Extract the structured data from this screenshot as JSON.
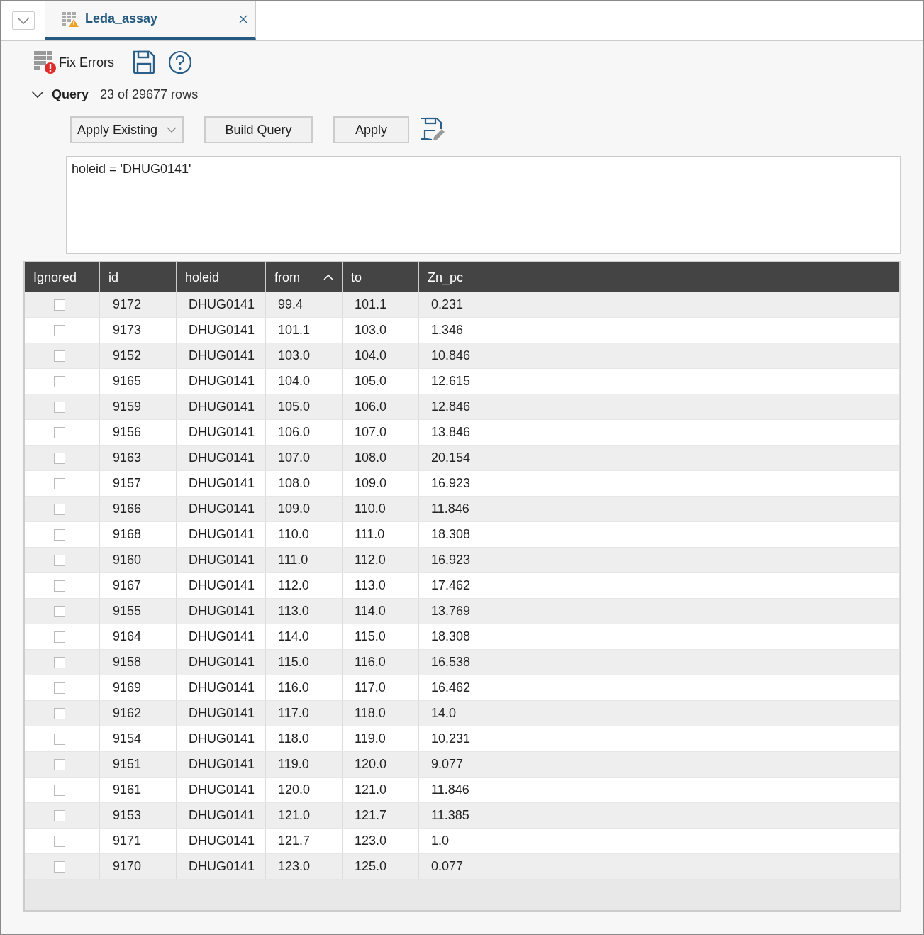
{
  "tab": {
    "title": "Leda_assay",
    "selected": true
  },
  "toolbar": {
    "fix_errors": "Fix Errors"
  },
  "query": {
    "label": "Query",
    "expanded": true,
    "count": "23 of 29677 rows",
    "apply_existing": "Apply Existing",
    "build_query": "Build Query",
    "apply": "Apply",
    "text": "holeid = 'DHUG0141'"
  },
  "table": {
    "columns": [
      {
        "label": "Ignored",
        "sorted": false
      },
      {
        "label": "id",
        "sorted": false
      },
      {
        "label": "holeid",
        "sorted": false
      },
      {
        "label": "from",
        "sorted": true
      },
      {
        "label": "to",
        "sorted": false
      },
      {
        "label": "Zn_pc",
        "sorted": false
      }
    ],
    "rows": [
      {
        "ignored": false,
        "id": "9172",
        "holeid": "DHUG0141",
        "from": "99.4",
        "to": "101.1",
        "zn_pc": "0.231"
      },
      {
        "ignored": false,
        "id": "9173",
        "holeid": "DHUG0141",
        "from": "101.1",
        "to": "103.0",
        "zn_pc": "1.346"
      },
      {
        "ignored": false,
        "id": "9152",
        "holeid": "DHUG0141",
        "from": "103.0",
        "to": "104.0",
        "zn_pc": "10.846"
      },
      {
        "ignored": false,
        "id": "9165",
        "holeid": "DHUG0141",
        "from": "104.0",
        "to": "105.0",
        "zn_pc": "12.615"
      },
      {
        "ignored": false,
        "id": "9159",
        "holeid": "DHUG0141",
        "from": "105.0",
        "to": "106.0",
        "zn_pc": "12.846"
      },
      {
        "ignored": false,
        "id": "9156",
        "holeid": "DHUG0141",
        "from": "106.0",
        "to": "107.0",
        "zn_pc": "13.846"
      },
      {
        "ignored": false,
        "id": "9163",
        "holeid": "DHUG0141",
        "from": "107.0",
        "to": "108.0",
        "zn_pc": "20.154"
      },
      {
        "ignored": false,
        "id": "9157",
        "holeid": "DHUG0141",
        "from": "108.0",
        "to": "109.0",
        "zn_pc": "16.923"
      },
      {
        "ignored": false,
        "id": "9166",
        "holeid": "DHUG0141",
        "from": "109.0",
        "to": "110.0",
        "zn_pc": "11.846"
      },
      {
        "ignored": false,
        "id": "9168",
        "holeid": "DHUG0141",
        "from": "110.0",
        "to": "111.0",
        "zn_pc": "18.308"
      },
      {
        "ignored": false,
        "id": "9160",
        "holeid": "DHUG0141",
        "from": "111.0",
        "to": "112.0",
        "zn_pc": "16.923"
      },
      {
        "ignored": false,
        "id": "9167",
        "holeid": "DHUG0141",
        "from": "112.0",
        "to": "113.0",
        "zn_pc": "17.462"
      },
      {
        "ignored": false,
        "id": "9155",
        "holeid": "DHUG0141",
        "from": "113.0",
        "to": "114.0",
        "zn_pc": "13.769"
      },
      {
        "ignored": false,
        "id": "9164",
        "holeid": "DHUG0141",
        "from": "114.0",
        "to": "115.0",
        "zn_pc": "18.308"
      },
      {
        "ignored": false,
        "id": "9158",
        "holeid": "DHUG0141",
        "from": "115.0",
        "to": "116.0",
        "zn_pc": "16.538"
      },
      {
        "ignored": false,
        "id": "9169",
        "holeid": "DHUG0141",
        "from": "116.0",
        "to": "117.0",
        "zn_pc": "16.462"
      },
      {
        "ignored": false,
        "id": "9162",
        "holeid": "DHUG0141",
        "from": "117.0",
        "to": "118.0",
        "zn_pc": "14.0"
      },
      {
        "ignored": false,
        "id": "9154",
        "holeid": "DHUG0141",
        "from": "118.0",
        "to": "119.0",
        "zn_pc": "10.231"
      },
      {
        "ignored": false,
        "id": "9151",
        "holeid": "DHUG0141",
        "from": "119.0",
        "to": "120.0",
        "zn_pc": "9.077"
      },
      {
        "ignored": false,
        "id": "9161",
        "holeid": "DHUG0141",
        "from": "120.0",
        "to": "121.0",
        "zn_pc": "11.846"
      },
      {
        "ignored": false,
        "id": "9153",
        "holeid": "DHUG0141",
        "from": "121.0",
        "to": "121.7",
        "zn_pc": "11.385"
      },
      {
        "ignored": false,
        "id": "9171",
        "holeid": "DHUG0141",
        "from": "121.7",
        "to": "123.0",
        "zn_pc": "1.0"
      },
      {
        "ignored": false,
        "id": "9170",
        "holeid": "DHUG0141",
        "from": "123.0",
        "to": "125.0",
        "zn_pc": "0.077"
      }
    ]
  }
}
